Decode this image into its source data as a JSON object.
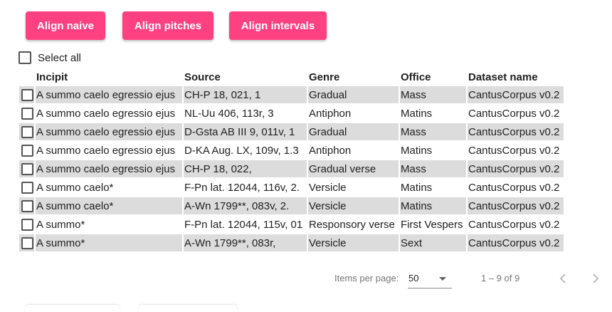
{
  "toolbar": {
    "buttons": [
      {
        "label": "Align naive"
      },
      {
        "label": "Align pitches"
      },
      {
        "label": "Align intervals"
      }
    ],
    "accent_color": "#ff4081"
  },
  "select_all": {
    "label": "Select all"
  },
  "table": {
    "headers": [
      "Incipit",
      "Source",
      "Genre",
      "Office",
      "Dataset name"
    ],
    "rows": [
      [
        "A summo caelo egressio ejus",
        "CH-P 18, 021, 1",
        "Gradual",
        "Mass",
        "CantusCorpus v0.2"
      ],
      [
        "A summo caelo egressio ejus",
        "NL-Uu 406, 113r, 3",
        "Antiphon",
        "Matins",
        "CantusCorpus v0.2"
      ],
      [
        "A summo caelo egressio ejus",
        "D-Gsta AB III 9, 011v, 1",
        "Gradual",
        "Mass",
        "CantusCorpus v0.2"
      ],
      [
        "A summo caelo egressio ejus",
        "D-KA Aug. LX, 109v, 1.3",
        "Antiphon",
        "Matins",
        "CantusCorpus v0.2"
      ],
      [
        "A summo caelo egressio ejus",
        "CH-P 18, 022,",
        "Gradual verse",
        "Mass",
        "CantusCorpus v0.2"
      ],
      [
        "A summo caelo*",
        "F-Pn lat. 12044, 116v, 2.",
        "Versicle",
        "Matins",
        "CantusCorpus v0.2"
      ],
      [
        "A summo caelo*",
        "A-Wn 1799**, 083v, 2.",
        "Versicle",
        "Matins",
        "CantusCorpus v0.2"
      ],
      [
        "A summo*",
        "F-Pn lat. 12044, 115v, 01",
        "Responsory verse",
        "First Vespers",
        "CantusCorpus v0.2"
      ],
      [
        "A summo*",
        "A-Wn 1799**, 083r,",
        "Versicle",
        "Sext",
        "CantusCorpus v0.2"
      ]
    ],
    "shaded_row_color": "#dcdcdc"
  },
  "paginator": {
    "items_per_page_label": "Items per page:",
    "items_per_page_value": "50",
    "range_label": "1 – 9 of 9",
    "prev_icon": "chevron-left-icon",
    "next_icon": "chevron-right-icon"
  }
}
